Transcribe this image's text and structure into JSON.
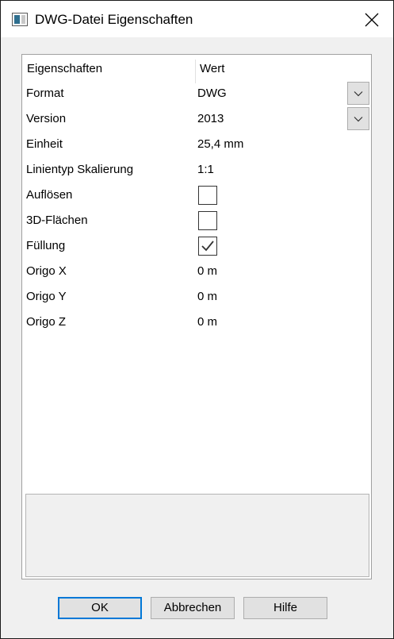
{
  "window": {
    "title": "DWG-Datei Eigenschaften",
    "icon": "app-window-icon",
    "close_icon": "close-icon"
  },
  "grid": {
    "header": {
      "name": "Eigenschaften",
      "value": "Wert"
    },
    "rows": [
      {
        "name": "Format",
        "value": "DWG",
        "kind": "dropdown"
      },
      {
        "name": "Version",
        "value": "2013",
        "kind": "dropdown"
      },
      {
        "name": "Einheit",
        "value": "25,4 mm",
        "kind": "text"
      },
      {
        "name": "Linientyp Skalierung",
        "value": "1:1",
        "kind": "text"
      },
      {
        "name": "Auflösen",
        "checked": false,
        "kind": "checkbox"
      },
      {
        "name": "3D-Flächen",
        "checked": false,
        "kind": "checkbox"
      },
      {
        "name": "Füllung",
        "checked": true,
        "kind": "checkbox"
      },
      {
        "name": "Origo X",
        "value": "0 m",
        "kind": "text"
      },
      {
        "name": "Origo Y",
        "value": "0 m",
        "kind": "text"
      },
      {
        "name": "Origo Z",
        "value": "0 m",
        "kind": "text"
      }
    ]
  },
  "buttons": {
    "ok": "OK",
    "cancel": "Abbrechen",
    "help": "Hilfe"
  },
  "colors": {
    "default_button_border": "#0078d7",
    "button_face": "#e1e1e1",
    "window_bg": "#f0f0f0"
  }
}
